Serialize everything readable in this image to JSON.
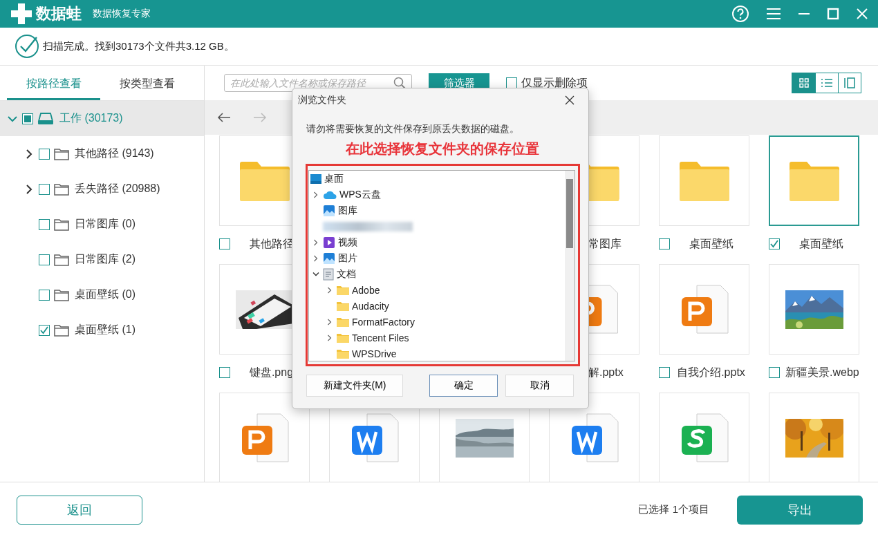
{
  "app": {
    "logo": "数据蛙",
    "subtitle": "数据恢复专家"
  },
  "status": {
    "message": "扫描完成。找到30173个文件共3.12 GB。"
  },
  "sidebar": {
    "tabs": [
      {
        "label": "按路径查看",
        "selected": true
      },
      {
        "label": "按类型查看",
        "selected": false
      }
    ],
    "tree": [
      {
        "label": "工作 (30173)",
        "kind": "drive",
        "expanded": true,
        "checked": false,
        "partial": true,
        "selected": true,
        "children": [
          {
            "label": "其他路径 (9143)",
            "kind": "folder",
            "expanded": false,
            "checked": false,
            "partial": false,
            "selected": false
          },
          {
            "label": "丢失路径 (20988)",
            "kind": "folder",
            "expanded": false,
            "checked": false,
            "partial": false,
            "selected": false
          },
          {
            "label": "日常图库 (0)",
            "kind": "folder",
            "checked": false,
            "partial": false,
            "selected": false
          },
          {
            "label": "日常图库 (2)",
            "kind": "folder",
            "checked": false,
            "partial": false,
            "selected": false
          },
          {
            "label": "桌面壁纸 (0)",
            "kind": "folder",
            "checked": false,
            "partial": false,
            "selected": false
          },
          {
            "label": "桌面壁纸 (1)",
            "kind": "folder",
            "checked": true,
            "selected": false
          }
        ]
      }
    ]
  },
  "toolbar": {
    "search": {
      "placeholder": "在此处输入文件名称或保存路径"
    },
    "filter_button": "筛选器",
    "deleted_only": {
      "label": "仅显示删除项",
      "checked": false
    },
    "views": [
      {
        "kind": "grid",
        "selected": true
      },
      {
        "kind": "list",
        "selected": false
      },
      {
        "kind": "columns",
        "selected": false
      }
    ]
  },
  "nav": [
    {
      "kind": "back",
      "disabled": false
    },
    {
      "kind": "forward",
      "disabled": true
    }
  ],
  "grid": {
    "items": [
      {
        "kind": "folder",
        "label": "其他路径",
        "checked": false,
        "selected": false
      },
      {
        "kind": "covered"
      },
      {
        "kind": "covered"
      },
      {
        "kind": "folder",
        "label": "常图库"
      },
      {
        "kind": "folder",
        "label": "桌面壁纸",
        "checked": false,
        "selected": false
      },
      {
        "kind": "folder",
        "label": "桌面壁纸",
        "checked": true,
        "selected": true
      },
      {
        "kind": "picture",
        "label": "键盘.png",
        "checked": false,
        "selected": false
      },
      {
        "kind": "covered"
      },
      {
        "kind": "covered"
      },
      {
        "kind": "ppt",
        "label": "解.pptx"
      },
      {
        "kind": "ppt",
        "label": "自我介绍.pptx",
        "checked": false,
        "selected": false
      },
      {
        "kind": "picture",
        "label": "新疆美景.webp",
        "checked": false,
        "selected": false
      },
      {
        "kind": "ppt"
      },
      {
        "kind": "word"
      },
      {
        "kind": "picture"
      },
      {
        "kind": "word"
      },
      {
        "kind": "sheet"
      },
      {
        "kind": "picture"
      }
    ]
  },
  "dialog": {
    "title": "浏览文件夹",
    "message": "请勿将需要恢复的文件保存到原丢失数据的磁盘。",
    "annotation": "在此选择恢复文件夹的保存位置",
    "tree": [
      {
        "label": "桌面",
        "kind": "desktop",
        "children": [
          {
            "label": "WPS云盘",
            "kind": "cloud",
            "expanded": false
          },
          {
            "label": "图库",
            "kind": "gallery"
          },
          {
            "kind": "blurred"
          },
          {
            "label": "视频",
            "kind": "video",
            "expanded": false
          },
          {
            "label": "图片",
            "kind": "pictures",
            "expanded": false
          },
          {
            "label": "文档",
            "kind": "documents",
            "expanded": true,
            "children": [
              {
                "label": "Adobe",
                "kind": "folder",
                "expanded": false
              },
              {
                "label": "Audacity",
                "kind": "folder"
              },
              {
                "label": "FormatFactory",
                "kind": "folder",
                "expanded": false
              },
              {
                "label": "Tencent Files",
                "kind": "folder",
                "expanded": false
              },
              {
                "label": "WPSDrive",
                "kind": "folder"
              }
            ]
          }
        ]
      }
    ],
    "buttons": [
      {
        "label": "新建文件夹(M)",
        "default": false
      },
      {
        "label": "确定",
        "default": true
      },
      {
        "label": "取消",
        "default": false
      }
    ]
  },
  "footer": {
    "back_button": "返回",
    "selection": "已选择 1个项目",
    "export_button": "导出"
  }
}
